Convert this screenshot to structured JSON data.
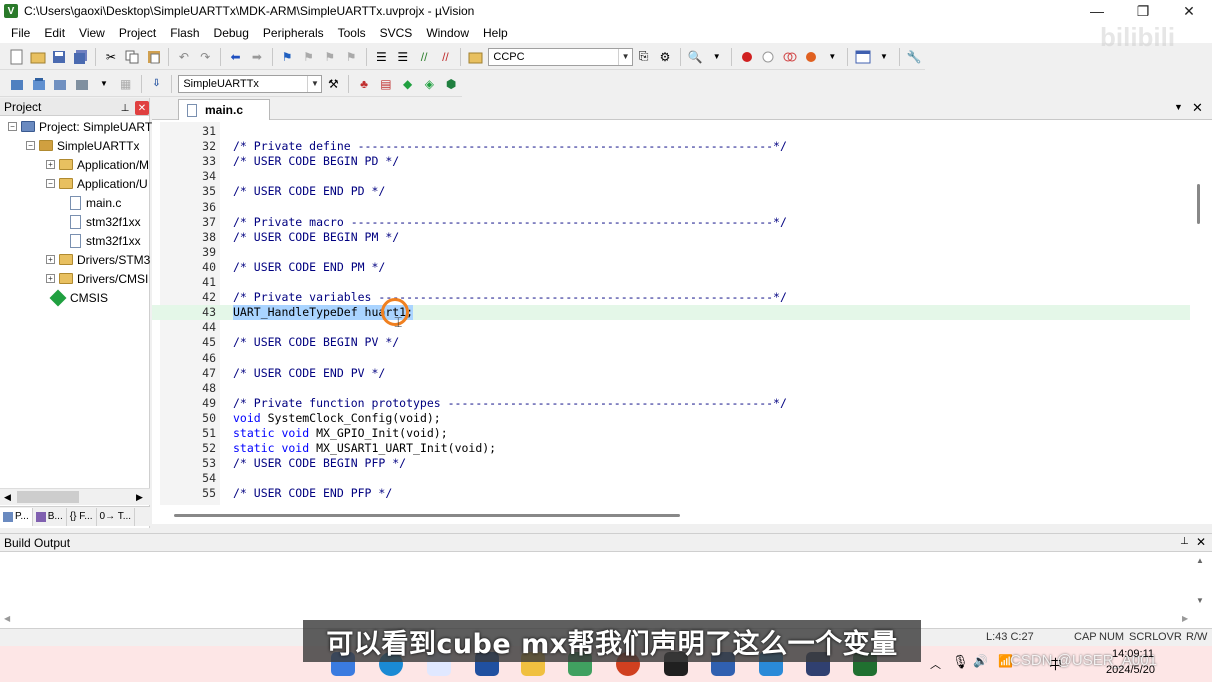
{
  "window": {
    "title": "C:\\Users\\gaoxi\\Desktop\\SimpleUARTTx\\MDK-ARM\\SimpleUARTTx.uvprojx - µVision",
    "app_icon_letter": "V",
    "minimize": "—",
    "maximize": "❐",
    "close": "✕"
  },
  "menu": [
    "File",
    "Edit",
    "View",
    "Project",
    "Flash",
    "Debug",
    "Peripherals",
    "Tools",
    "SVCS",
    "Window",
    "Help"
  ],
  "toolbar1": {
    "find_combo_value": "CCPC"
  },
  "toolbar2": {
    "target_combo_value": "SimpleUARTTx"
  },
  "project_panel": {
    "title": "Project",
    "tree": [
      {
        "label": "Project: SimpleUARTT",
        "indent": 0,
        "expander": "−",
        "icon": "project-icon"
      },
      {
        "label": "SimpleUARTTx",
        "indent": 1,
        "expander": "−",
        "icon": "target-icon"
      },
      {
        "label": "Application/M",
        "indent": 2,
        "expander": "+",
        "icon": "folder-icon"
      },
      {
        "label": "Application/U",
        "indent": 2,
        "expander": "−",
        "icon": "folder-icon"
      },
      {
        "label": "main.c",
        "indent": 3,
        "expander": "",
        "icon": "file-icon"
      },
      {
        "label": "stm32f1xx",
        "indent": 3,
        "expander": "",
        "icon": "file-icon"
      },
      {
        "label": "stm32f1xx",
        "indent": 3,
        "expander": "",
        "icon": "file-icon"
      },
      {
        "label": "Drivers/STM3",
        "indent": 2,
        "expander": "+",
        "icon": "folder-icon"
      },
      {
        "label": "Drivers/CMSI",
        "indent": 2,
        "expander": "+",
        "icon": "folder-icon"
      },
      {
        "label": "CMSIS",
        "indent": 2,
        "expander": "",
        "icon": "gem-icon"
      }
    ],
    "bottom_tabs": [
      "P...",
      "B...",
      "{} F...",
      "0→ T..."
    ]
  },
  "editor": {
    "active_tab": "main.c",
    "lines": [
      {
        "n": "31",
        "text": ""
      },
      {
        "n": "32",
        "text": "/* Private define ------------------------------------------------------------*/"
      },
      {
        "n": "33",
        "text": "/* USER CODE BEGIN PD */"
      },
      {
        "n": "34",
        "text": ""
      },
      {
        "n": "35",
        "text": "/* USER CODE END PD */"
      },
      {
        "n": "36",
        "text": ""
      },
      {
        "n": "37",
        "text": "/* Private macro -------------------------------------------------------------*/"
      },
      {
        "n": "38",
        "text": "/* USER CODE BEGIN PM */"
      },
      {
        "n": "39",
        "text": ""
      },
      {
        "n": "40",
        "text": "/* USER CODE END PM */"
      },
      {
        "n": "41",
        "text": ""
      },
      {
        "n": "42",
        "text": "/* Private variables ---------------------------------------------------------*/"
      },
      {
        "n": "43",
        "text": "UART_HandleTypeDef huart1;"
      },
      {
        "n": "44",
        "text": ""
      },
      {
        "n": "45",
        "text": "/* USER CODE BEGIN PV */"
      },
      {
        "n": "46",
        "text": ""
      },
      {
        "n": "47",
        "text": "/* USER CODE END PV */"
      },
      {
        "n": "48",
        "text": ""
      },
      {
        "n": "49",
        "text": "/* Private function prototypes -----------------------------------------------*/"
      },
      {
        "n": "50",
        "text": "void SystemClock_Config(void);"
      },
      {
        "n": "51",
        "text": "static void MX_GPIO_Init(void);"
      },
      {
        "n": "52",
        "text": "static void MX_USART1_UART_Init(void);"
      },
      {
        "n": "53",
        "text": "/* USER CODE BEGIN PFP */"
      },
      {
        "n": "54",
        "text": ""
      },
      {
        "n": "55",
        "text": "/* USER CODE END PFP */"
      }
    ],
    "highlighted_line": "43"
  },
  "build_output": {
    "title": "Build Output"
  },
  "status_bar": {
    "position": "L:43 C:27",
    "flags": [
      "CAP",
      "NUM",
      "SCRL",
      "OVR",
      "R/W"
    ]
  },
  "taskbar": {
    "ime": "中",
    "time": "14:09:11",
    "date": "2024/5/20",
    "overlay_text": "CSDN @USER_A001"
  },
  "subtitle": "可以看到cube mx帮我们声明了这么一个变量",
  "watermark": "bilibili"
}
